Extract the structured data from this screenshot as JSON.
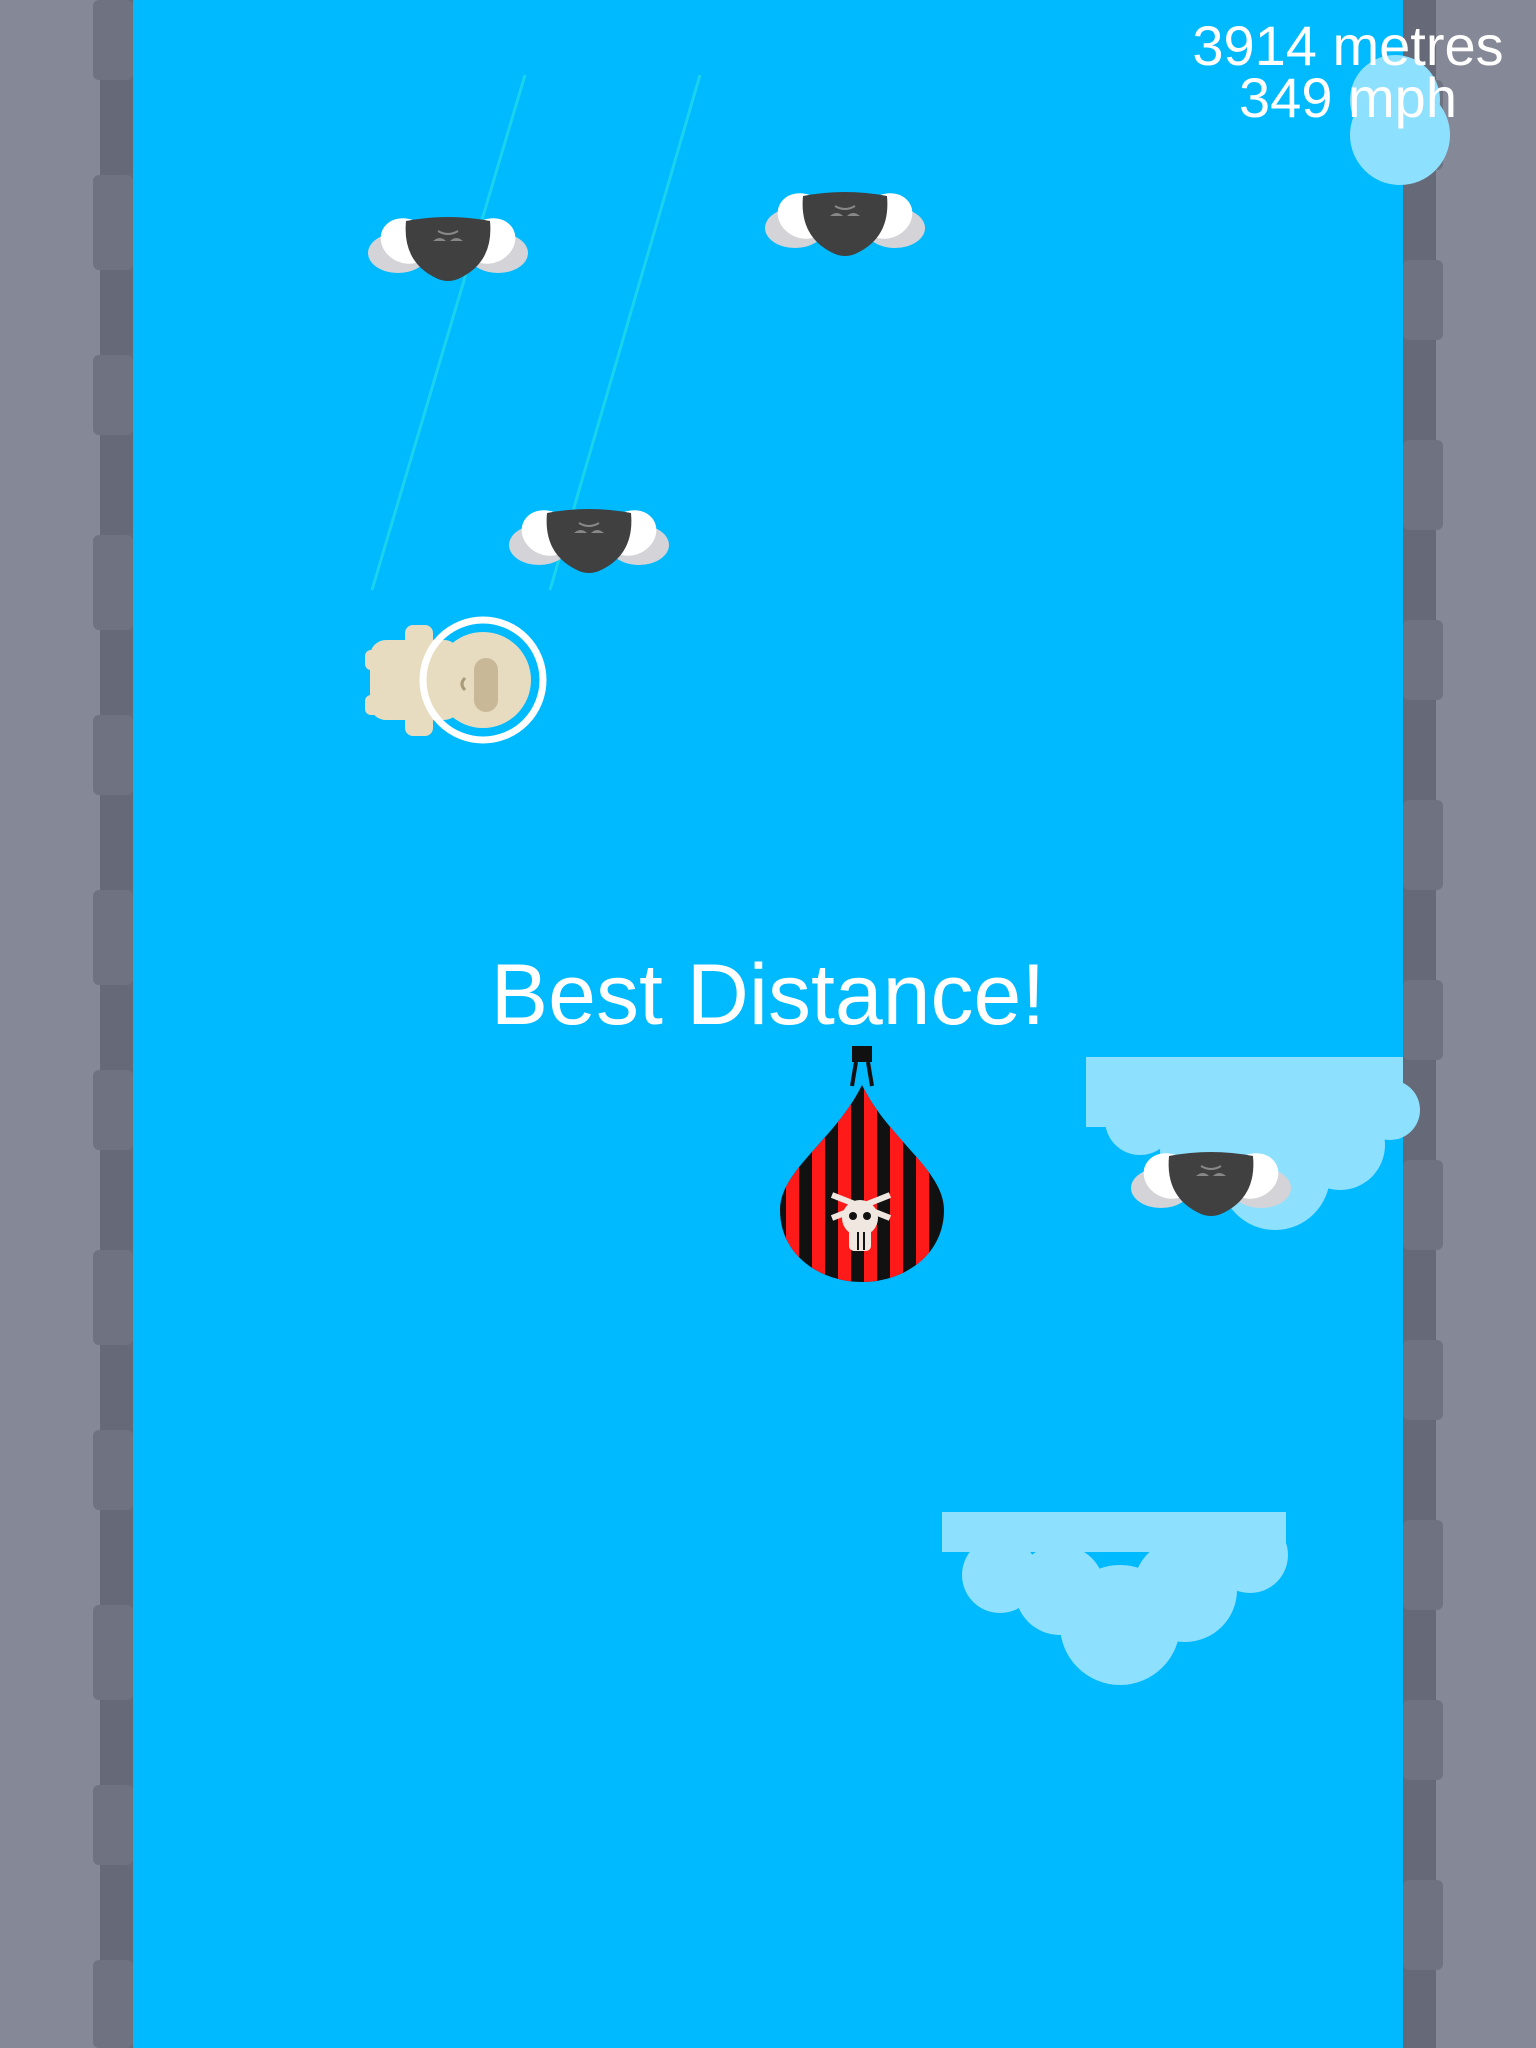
{
  "hud": {
    "distance": "3914 metres",
    "speed": "349 mph"
  },
  "banner": {
    "text": "Best Distance!"
  },
  "colors": {
    "sky": "#00baff",
    "wall": "#858896",
    "cloud": "#8ee0ff",
    "enemy": "#404040",
    "balloon_red": "#ff1a1a",
    "balloon_black": "#111111"
  },
  "icons": {
    "enemy": "flying-bug-icon",
    "player": "skydiver-icon",
    "hazard": "pirate-balloon-icon"
  }
}
